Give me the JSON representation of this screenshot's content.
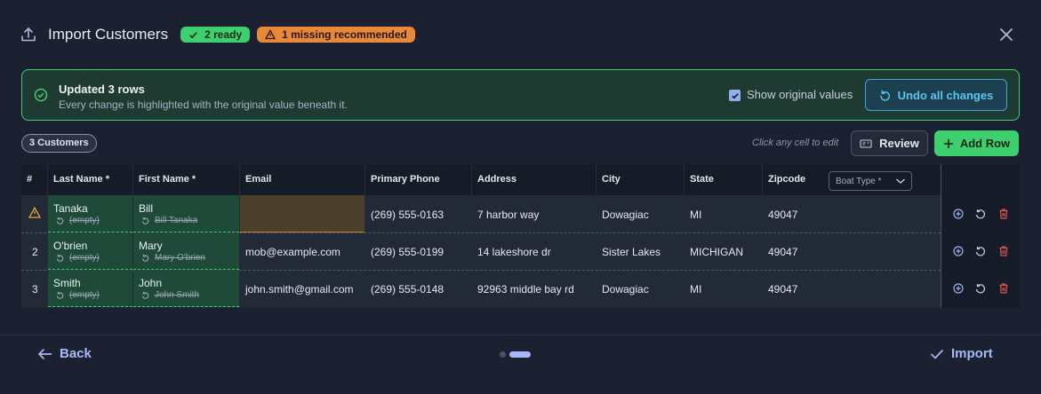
{
  "header": {
    "title": "Import Customers",
    "ready_badge": "2 ready",
    "warning_badge": "1 missing recommended"
  },
  "banner": {
    "title": "Updated 3 rows",
    "subtitle": "Every change is highlighted with the original value beneath it.",
    "show_original_label": "Show original values",
    "show_original_checked": true,
    "undo_label": "Undo all changes"
  },
  "toolbar": {
    "count_pill": "3 Customers",
    "hint": "Click any cell to edit",
    "review_label": "Review",
    "add_row_label": "Add Row"
  },
  "table": {
    "columns": {
      "num": "#",
      "last": "Last Name *",
      "first": "First Name *",
      "email": "Email",
      "phone": "Primary Phone",
      "address": "Address",
      "city": "City",
      "state": "State",
      "zip": "Zipcode",
      "boat": "Boat Type *"
    },
    "rows": [
      {
        "num": "",
        "status": "warning",
        "last": "Tanaka",
        "last_orig": "(empty)",
        "first": "Bill",
        "first_orig": "Bill Tanaka",
        "email": "",
        "phone": "(269) 555-0163",
        "address": "7 harbor way",
        "city": "Dowagiac",
        "state": "MI",
        "zip": "49047"
      },
      {
        "num": "2",
        "last": "O'brien",
        "last_orig": "(empty)",
        "first": "Mary",
        "first_orig": "Mary O'brien",
        "email": "mob@example.com",
        "phone": "(269) 555-0199",
        "address": "14 lakeshore dr",
        "city": "Sister Lakes",
        "state": "MICHIGAN",
        "zip": "49047"
      },
      {
        "num": "3",
        "last": "Smith",
        "last_orig": "(empty)",
        "first": "John",
        "first_orig": "John Smith",
        "email": "john.smith@gmail.com",
        "phone": "(269) 555-0148",
        "address": "92963 middle bay rd",
        "city": "Dowagiac",
        "state": "MI",
        "zip": "49047"
      }
    ]
  },
  "footer": {
    "back_label": "Back",
    "import_label": "Import",
    "step_current": 2,
    "step_total": 2
  },
  "colors": {
    "accent_green": "#3ecf6e",
    "accent_orange": "#e8893a",
    "accent_blue": "#3fa7d6",
    "link": "#a9b9f5",
    "delete_red": "#e05252"
  },
  "icons": [
    "upload-icon",
    "check-icon",
    "warning-icon",
    "close-icon",
    "check-circle-icon",
    "undo-icon",
    "id-card-icon",
    "plus-icon",
    "chevron-down-icon",
    "add-circle-icon",
    "reset-icon",
    "trash-icon",
    "arrow-left-icon"
  ]
}
